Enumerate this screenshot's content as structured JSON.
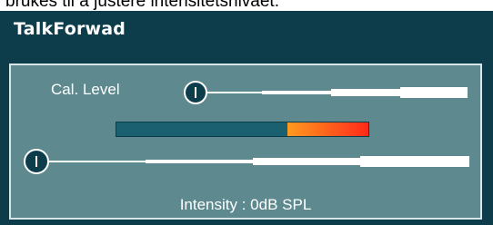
{
  "caption": {
    "text": "brukes til å justere intensitetsnivået."
  },
  "window": {
    "title": "TalkForwad"
  },
  "panel": {
    "cal_level_label": "Cal. Level",
    "intensity_text": "Intensity : 0dB SPL"
  },
  "cal_level_slider": {
    "value_fraction": 0.0
  },
  "level_meter": {
    "level_fraction": 0.68,
    "peak_fraction": 1.0
  },
  "intensity_slider": {
    "value_fraction": 0.0
  },
  "colors": {
    "window_bg": "#0d3d4b",
    "panel_bg": "#5e8a8f",
    "meter_peak_start": "#ff9a1f",
    "meter_peak_end": "#ff2a1a"
  }
}
